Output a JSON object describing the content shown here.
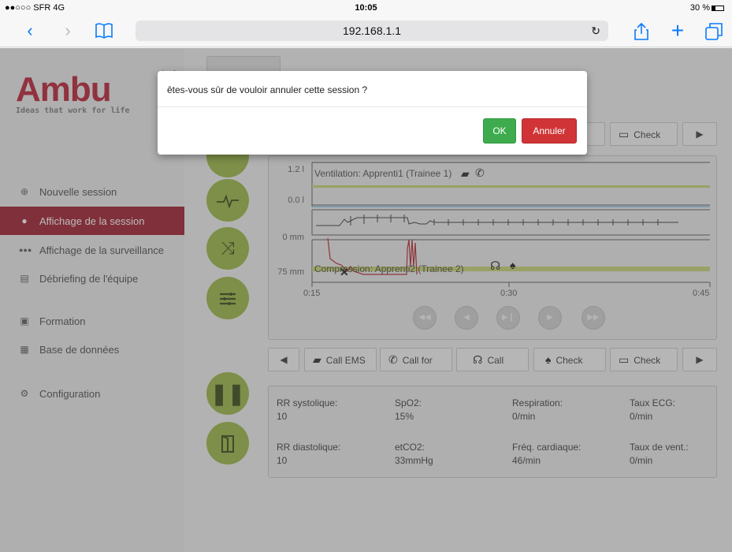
{
  "status_bar": {
    "carrier": "●●○○○ SFR  4G",
    "time": "10:05",
    "battery": "30 %"
  },
  "browser": {
    "url": "192.168.1.1"
  },
  "logo": {
    "brand": "Ambu",
    "tagline": "Ideas that work for life"
  },
  "sidebar": {
    "items": [
      {
        "label": "Nouvelle session",
        "icon": "plus-circle-icon"
      },
      {
        "label": "Affichage de la session",
        "icon": "person-icon"
      },
      {
        "label": "Affichage de la surveillance",
        "icon": "group-icon"
      },
      {
        "label": "Débriefing de l'équipe",
        "icon": "document-icon"
      },
      {
        "label": "Formation",
        "icon": "presentation-icon"
      },
      {
        "label": "Base de données",
        "icon": "database-icon"
      },
      {
        "label": "Configuration",
        "icon": "gears-icon"
      }
    ]
  },
  "top_toolbar": {
    "partial_label": "k",
    "check_label": "Check"
  },
  "chart": {
    "ventilation_scale_top": "1.2 l",
    "ventilation_scale_bottom": "0.0 l",
    "ventilation_label": "Ventilation: Apprenti1 (Trainee 1)",
    "compression_scale_top": "0 mm",
    "compression_scale_bottom": "75 mm",
    "compression_label": "Compression: Apprenti2 (Trainee 2)",
    "time_ticks": [
      "0:15",
      "0:30",
      "0:45"
    ]
  },
  "bottom_toolbar": {
    "items": [
      {
        "label": "Call EMS",
        "icon": "ambulance-icon"
      },
      {
        "label": "Call for",
        "icon": "phone-icon"
      },
      {
        "label": "Call",
        "icon": "stethoscope-icon"
      },
      {
        "label": "Check",
        "icon": "lungs-icon"
      },
      {
        "label": "Check",
        "icon": "monitor-icon"
      }
    ]
  },
  "vitals": {
    "rr_sys": {
      "label": "RR systolique:",
      "value": "10"
    },
    "spo2": {
      "label": "SpO2:",
      "value": "15%"
    },
    "resp": {
      "label": "Respiration:",
      "value": "0/min"
    },
    "ecg": {
      "label": "Taux ECG:",
      "value": "0/min"
    },
    "rr_dia": {
      "label": "RR diastolique:",
      "value": "10"
    },
    "etco2": {
      "label": "etCO2:",
      "value": "33mmHg"
    },
    "hr": {
      "label": "Fréq. cardiaque:",
      "value": "46/min"
    },
    "vent": {
      "label": "Taux de vent.:",
      "value": "0/min"
    }
  },
  "dialog": {
    "message": "êtes-vous sûr de vouloir annuler cette session ?",
    "ok_label": "OK",
    "cancel_label": "Annuler"
  },
  "colors": {
    "accent_red": "#9b1223",
    "circle_green": "#97b53c",
    "ok_green": "#3eac4e",
    "cancel_red": "#d03437"
  }
}
